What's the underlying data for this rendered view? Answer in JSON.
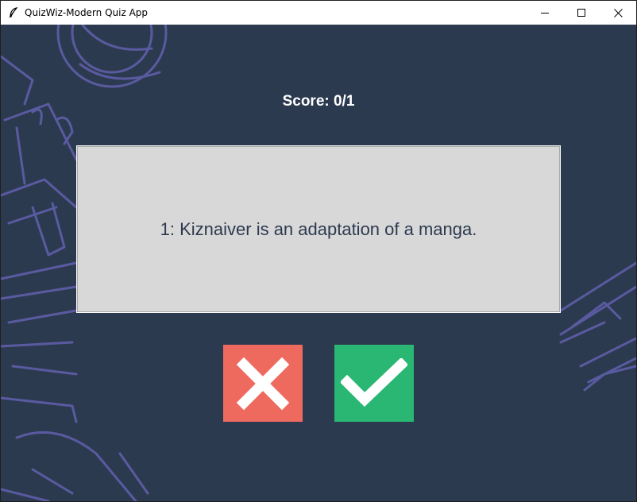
{
  "window": {
    "title": "QuizWiz-Modern Quiz App",
    "controls": [
      "minimize-icon",
      "maximize-icon",
      "close-icon"
    ]
  },
  "quiz": {
    "score_text": "Score: 0/1",
    "question_text": "1: Kiznaiver is an adaptation of a manga."
  },
  "buttons": {
    "false_icon": "cross-icon",
    "true_icon": "checkmark-icon"
  },
  "colors": {
    "background": "#2c3a4f",
    "card": "#d8d8d8",
    "false_button": "#ee6a5f",
    "true_button": "#2ab673",
    "doodle_lines": "#5a5aa0"
  }
}
